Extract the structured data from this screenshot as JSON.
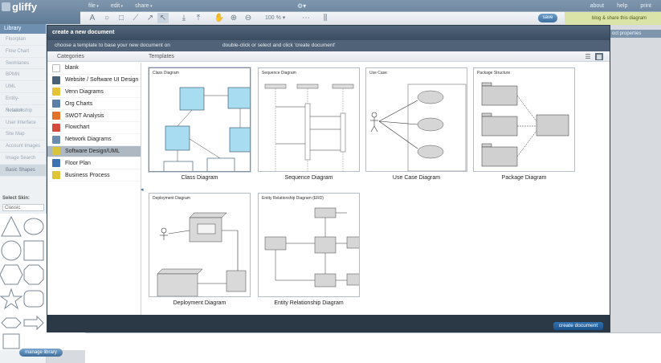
{
  "app": {
    "logo": "gliffy"
  },
  "menu": [
    "file",
    "edit",
    "share"
  ],
  "right_menu": [
    "about",
    "help",
    "print"
  ],
  "toolbar": {
    "zoom": "100 %",
    "save_label": "save",
    "share_label": "blog & share this diagram"
  },
  "library": {
    "header": "Library",
    "items": [
      "Floorplan",
      "Flow Chart",
      "Swimlanes",
      "BPMN",
      "UML",
      "Entity-Relationship",
      "Network",
      "User Interface",
      "Site Map",
      "Account Images",
      "Image Search",
      "Basic Shapes"
    ],
    "skin_label": "Select Skin:",
    "skin_value": "Classic",
    "manage_label": "manage library"
  },
  "properties_label": "oct properties",
  "dialog": {
    "title": "create a new document",
    "instruction_left": "choose a template to base your new document on",
    "instruction_right": "double-click or select and click 'create document'",
    "categories_header": "Categories",
    "templates_header": "Templates",
    "categories": [
      {
        "label": "blank",
        "color": "#ffffff"
      },
      {
        "label": "Website / Software UI Design",
        "color": "#4a5f78"
      },
      {
        "label": "Venn Diagrams",
        "color": "#e6c236"
      },
      {
        "label": "Org Charts",
        "color": "#5b7fa6"
      },
      {
        "label": "SWOT Analysis",
        "color": "#e0722d"
      },
      {
        "label": "Flowchart",
        "color": "#d44a3a"
      },
      {
        "label": "Network Diagrams",
        "color": "#6a8cb0"
      },
      {
        "label": "Software Design/UML",
        "color": "#d8c43a",
        "selected": true
      },
      {
        "label": "Floor Plan",
        "color": "#3d73b0"
      },
      {
        "label": "Business Process",
        "color": "#e0c437"
      }
    ],
    "templates": [
      {
        "caption": "Class Diagram",
        "title": "Class Diagram",
        "selected": true
      },
      {
        "caption": "Sequence Diagram",
        "title": "Sequence Diagram"
      },
      {
        "caption": "Use Case Diagram",
        "title": "Use Case"
      },
      {
        "caption": "Package Diagram",
        "title": "Package Structure"
      },
      {
        "caption": "Deployment Diagram",
        "title": "Deployment Diagram"
      },
      {
        "caption": "Entity Relationship Diagram",
        "title": "Entity Relationship Diagram (ERD)"
      }
    ],
    "create_label": "create document"
  }
}
